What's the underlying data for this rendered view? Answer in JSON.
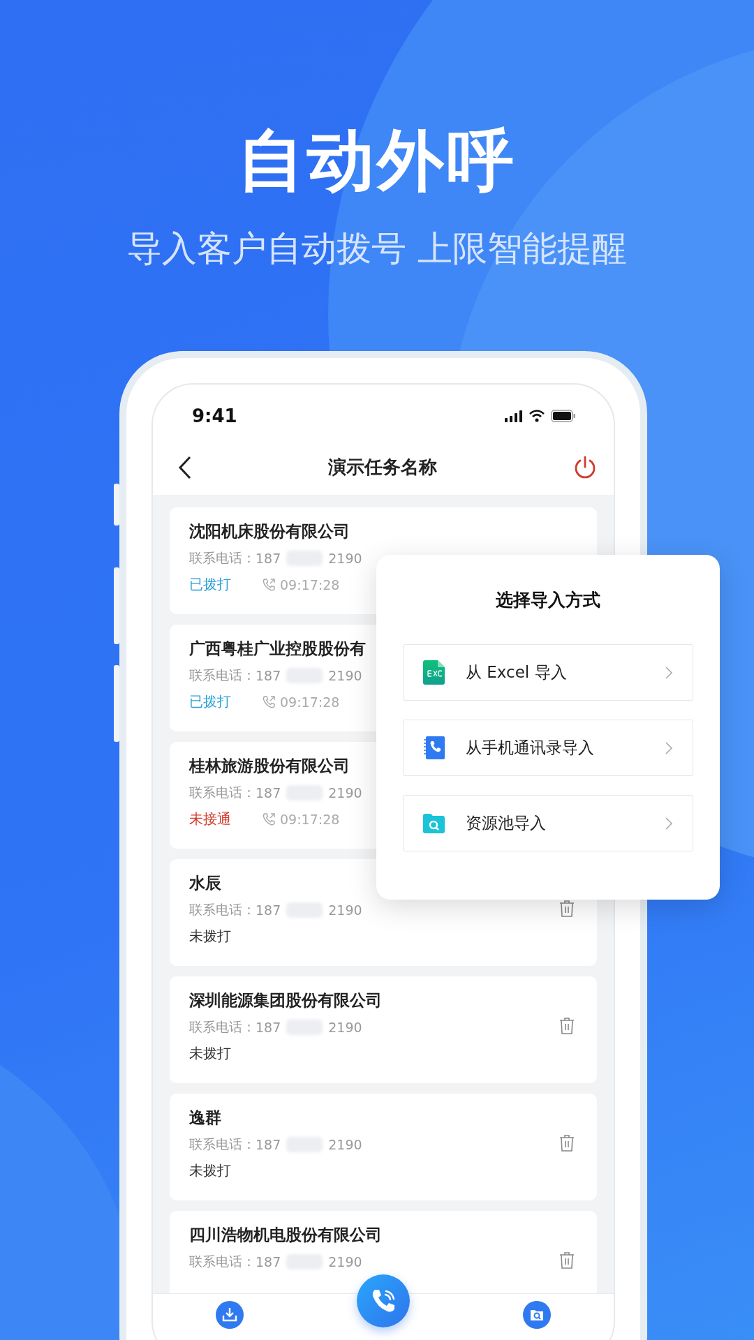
{
  "headline": "自动外呼",
  "subtitle": "导入客户自动拨号 上限智能提醒",
  "phone": {
    "status_bar": {
      "time": "9:41"
    },
    "header": {
      "title": "演示任务名称"
    },
    "customers": [
      {
        "name": "沈阳机床股份有限公司",
        "phone_label": "联系电话：",
        "phone_start": "187",
        "phone_end": "2190",
        "status": "已拨打",
        "color": "#2a9fd6",
        "time": "09:17:28"
      },
      {
        "name": "广西粤桂广业控股股份有",
        "phone_label": "联系电话：",
        "phone_start": "187",
        "phone_end": "2190",
        "status": "已拨打",
        "color": "#2a9fd6",
        "time": "09:17:28"
      },
      {
        "name": "桂林旅游股份有限公司",
        "phone_label": "联系电话：",
        "phone_start": "187",
        "phone_end": "2190",
        "status": "未接通",
        "color": "#d23a2c",
        "time": "09:17:28"
      },
      {
        "name": "水辰",
        "phone_label": "联系电话：",
        "phone_start": "187",
        "phone_end": "2190",
        "status": "未拨打",
        "color": "#333333"
      },
      {
        "name": "深圳能源集团股份有限公司",
        "phone_label": "联系电话：",
        "phone_start": "187",
        "phone_end": "2190",
        "status": "未拨打",
        "color": "#333333"
      },
      {
        "name": "逸群",
        "phone_label": "联系电话：",
        "phone_start": "187",
        "phone_end": "2190",
        "status": "未拨打",
        "color": "#333333"
      },
      {
        "name": "四川浩物机电股份有限公司",
        "phone_label": "联系电话：",
        "phone_start": "187",
        "phone_end": "2190"
      }
    ],
    "bottom_nav": [
      {
        "kind": "import"
      },
      {
        "kind": "call"
      },
      {
        "kind": "resource"
      }
    ]
  },
  "import_dialog": {
    "title": "选择导入方式",
    "options": [
      {
        "label": "从 Excel 导入",
        "kind": "excel"
      },
      {
        "label": "从手机通讯录导入",
        "kind": "contacts"
      },
      {
        "label": "资源池导入",
        "kind": "pool"
      }
    ]
  }
}
